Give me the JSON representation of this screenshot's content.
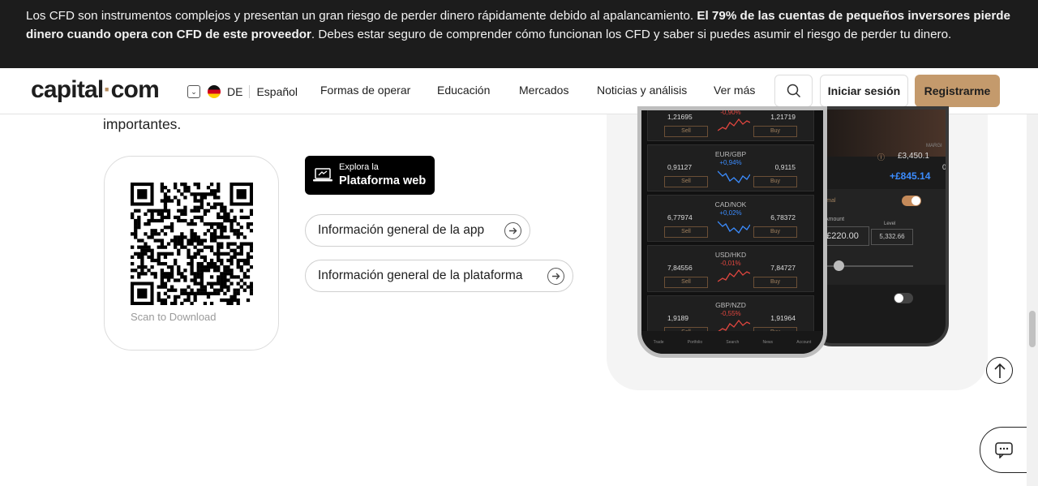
{
  "risk_banner": {
    "text_before": "Los CFD son instrumentos complejos y presentan un gran riesgo de perder dinero rápidamente debido al apalancamiento. ",
    "text_bold": "El 79% de las cuentas de pequeños inversores pierde dinero cuando opera con CFD de este proveedor",
    "text_after": ". Debes estar seguro de comprender cómo funcionan los CFD y saber si puedes asumir el riesgo de perder tu dinero."
  },
  "header": {
    "logo_left": "capital",
    "logo_dot": "·",
    "logo_right": "com",
    "lang_code": "DE",
    "lang_label": "Español",
    "nav": [
      "Formas de operar",
      "Educación",
      "Mercados",
      "Noticias y análisis",
      "Ver más"
    ],
    "login_label": "Iniciar sesión",
    "register_label": "Registrarme"
  },
  "main": {
    "intro_tail": "importantes.",
    "qr_caption": "Scan to Download",
    "web_badge_small": "Explora la",
    "web_badge_big": "Plataforma web",
    "app_overview_label": "Información general de la app",
    "platform_overview_label": "Información general de la plataforma"
  },
  "phone": {
    "quotes": [
      {
        "pair": "",
        "bid": "1,21695",
        "chg": "-0,90%",
        "ask": "1,21719",
        "color": "#e0463f"
      },
      {
        "pair": "EUR/GBP",
        "bid": "0,91127",
        "chg": "+0,94%",
        "ask": "0,9115",
        "color": "#3b8cff"
      },
      {
        "pair": "CAD/NOK",
        "bid": "6,77974",
        "chg": "+0,02%",
        "ask": "6,78372",
        "color": "#3b8cff"
      },
      {
        "pair": "USD/HKD",
        "bid": "7,84556",
        "chg": "-0,01%",
        "ask": "7,84727",
        "color": "#e0463f"
      },
      {
        "pair": "GBP/NZD",
        "bid": "1,9189",
        "chg": "-0,55%",
        "ask": "1,91964",
        "color": "#e0463f"
      }
    ],
    "sell_label": "Sell",
    "buy_label": "Buy",
    "tabs": [
      "Trade",
      "Portfolio",
      "Search",
      "News",
      "Account"
    ],
    "balance_label": "MARGI",
    "balance": "£3,450.1",
    "zero": "0",
    "pnl": "+£845.14",
    "order_type": "Normal",
    "amount_label": "Amount",
    "level_label": "Level",
    "amount": "£220.00",
    "level": "5,332.66"
  }
}
